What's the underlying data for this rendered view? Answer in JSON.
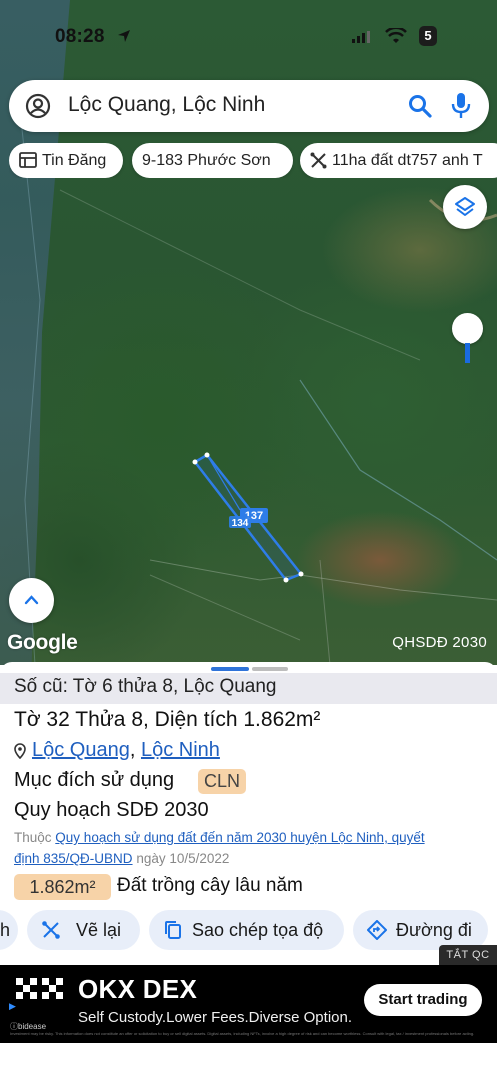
{
  "status": {
    "time": "08:28",
    "battery": "5"
  },
  "search": {
    "query": "Lộc Quang, Lộc Ninh"
  },
  "chips": [
    {
      "label": "Tin Đăng"
    },
    {
      "label": "9-183 Phước Sơn"
    },
    {
      "label": "11ha đất dt757 anh T"
    }
  ],
  "map": {
    "parcel_labels": [
      "137",
      "134"
    ],
    "attribution": "Google",
    "layer_label": "QHSDĐ 2030"
  },
  "sheet": {
    "old_info": "Số cũ: Tờ 6 thửa 8, Lộc Quang",
    "title": "Tờ 32 Thửa 8, Diện tích 1.862m²",
    "location_commune": "Lộc Quang",
    "location_district": "Lộc Ninh",
    "purpose_label": "Mục đích sử dụng",
    "purpose_code": "CLN",
    "plan_label": "Quy hoạch SDĐ 2030",
    "ref_prefix": "Thuộc",
    "ref_link_1": "Quy hoạch sử dụng đất đến năm 2030 huyện Lộc Ninh, quyết",
    "ref_link_2": "định 835/QĐ-UBND",
    "ref_date": "ngày 10/5/2022",
    "area_value": "1.862m²",
    "area_type": "Đất trồng cây lâu năm"
  },
  "actions": [
    {
      "label": "h"
    },
    {
      "label": "Vẽ lại"
    },
    {
      "label": "Sao chép tọa độ"
    },
    {
      "label": "Đường đi"
    }
  ],
  "ad_close": "TẮT QC",
  "ad": {
    "brand": "OKX DEX",
    "tagline": "Self Custody.Lower Fees.Diverse Option.",
    "cta": "Start trading",
    "advertiser": "ⓘbidease",
    "disclaimer": "Investment may be risky. This information does not constitute an offer or solicitation to buy or sell digital assets. Digital assets, including NFTs, involve a high degree of risk and can become worthless. Consult with legal, tax / investment professionals before acting."
  }
}
